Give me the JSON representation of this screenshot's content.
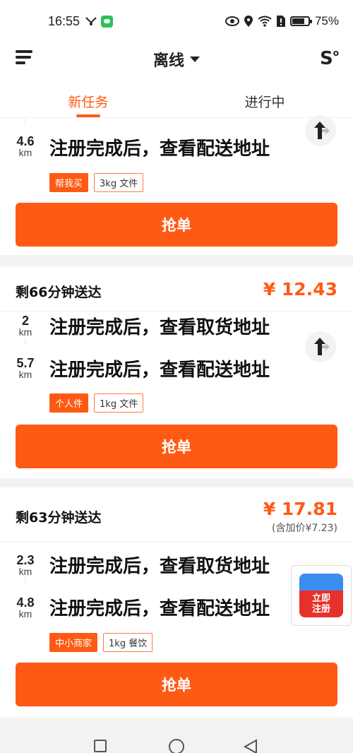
{
  "status_bar": {
    "time": "16:55",
    "battery_text": "75%",
    "battery_level": 0.75
  },
  "header": {
    "status_label": "离线",
    "route_label": "S"
  },
  "tabs": [
    {
      "label": "新任务",
      "active": true
    },
    {
      "label": "进行中",
      "active": false
    }
  ],
  "orders": [
    {
      "deadline": "",
      "price": "",
      "stops": [
        {
          "distance": "4.6",
          "unit": "km",
          "address": "注册完成后，查看配送地址"
        }
      ],
      "tags": [
        {
          "label": "帮我买",
          "style": "solid"
        },
        {
          "label": "3kg 文件",
          "style": "outline"
        }
      ],
      "button_label": "抢单"
    },
    {
      "deadline": "剩66分钟送达",
      "price": "¥ 12.43",
      "stops": [
        {
          "distance": "2",
          "unit": "km",
          "address": "注册完成后，查看取货地址"
        },
        {
          "distance": "5.7",
          "unit": "km",
          "address": "注册完成后，查看配送地址"
        }
      ],
      "tags": [
        {
          "label": "个人件",
          "style": "solid"
        },
        {
          "label": "1kg 文件",
          "style": "outline"
        }
      ],
      "button_label": "抢单"
    },
    {
      "deadline": "剩63分钟送达",
      "price": "¥ 17.81",
      "price_note": "(含加价¥7.23)",
      "stops": [
        {
          "distance": "2.3",
          "unit": "km",
          "address": "注册完成后，查看取货地址"
        },
        {
          "distance": "4.8",
          "unit": "km",
          "address": "注册完成后，查看配送地址"
        }
      ],
      "tags": [
        {
          "label": "中小商家",
          "style": "solid"
        },
        {
          "label": "1kg 餐饮",
          "style": "outline"
        }
      ],
      "button_label": "抢单"
    }
  ],
  "promo": {
    "label_line1": "立即",
    "label_line2": "注册"
  },
  "colors": {
    "accent": "#ff5a14"
  }
}
